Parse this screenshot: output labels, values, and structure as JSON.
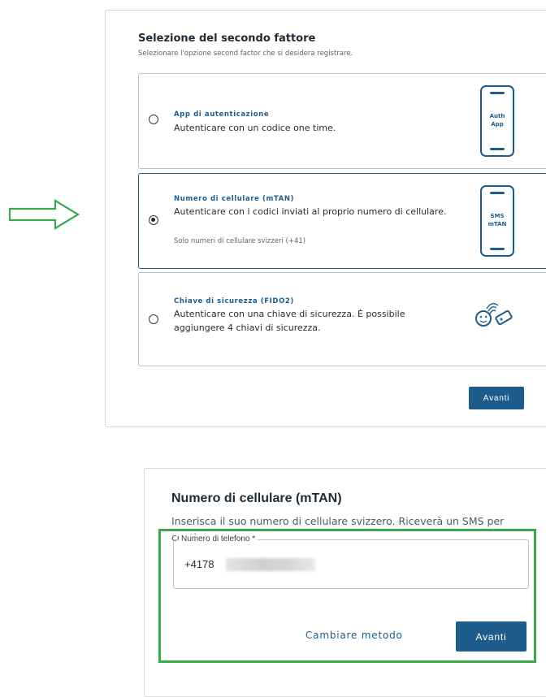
{
  "selection": {
    "title": "Selezione del secondo fattore",
    "subtitle": "Selezionare l'opzione second factor che si desidera registrare.",
    "options": [
      {
        "label": "App di autenticazione",
        "description": "Autenticare con un codice one time.",
        "icon": "auth-app-phone-icon",
        "icon_text_1": "Auth",
        "icon_text_2": "App",
        "selected": false
      },
      {
        "label": "Numero di cellulare (mTAN)",
        "description": "Autenticare con i codici inviati al proprio numero di cellulare.",
        "note": "Solo numeri di cellulare svizzeri (+41)",
        "icon": "sms-phone-icon",
        "icon_text_1": "SMS",
        "icon_text_2": "mTAN",
        "selected": true
      },
      {
        "label": "Chiave di sicurezza (FIDO2)",
        "description": "Autenticare con una chiave di sicurezza. È possibile aggiungere 4 chiavi di sicurezza.",
        "icon": "security-key-icon",
        "selected": false
      }
    ],
    "next_label": "Avanti"
  },
  "mtan": {
    "title": "Numero di cellulare (mTAN)",
    "subtitle": "Inserisca il suo numero di cellulare svizzero. Riceverà un SMS per continuare.",
    "phone_field_label": "Numero di telefono *",
    "phone_value": "+4178",
    "change_method_label": "Cambiare metodo",
    "next_label": "Avanti"
  },
  "colors": {
    "primary": "#1d5c8c",
    "annotation_green": "#3aaa4a"
  }
}
